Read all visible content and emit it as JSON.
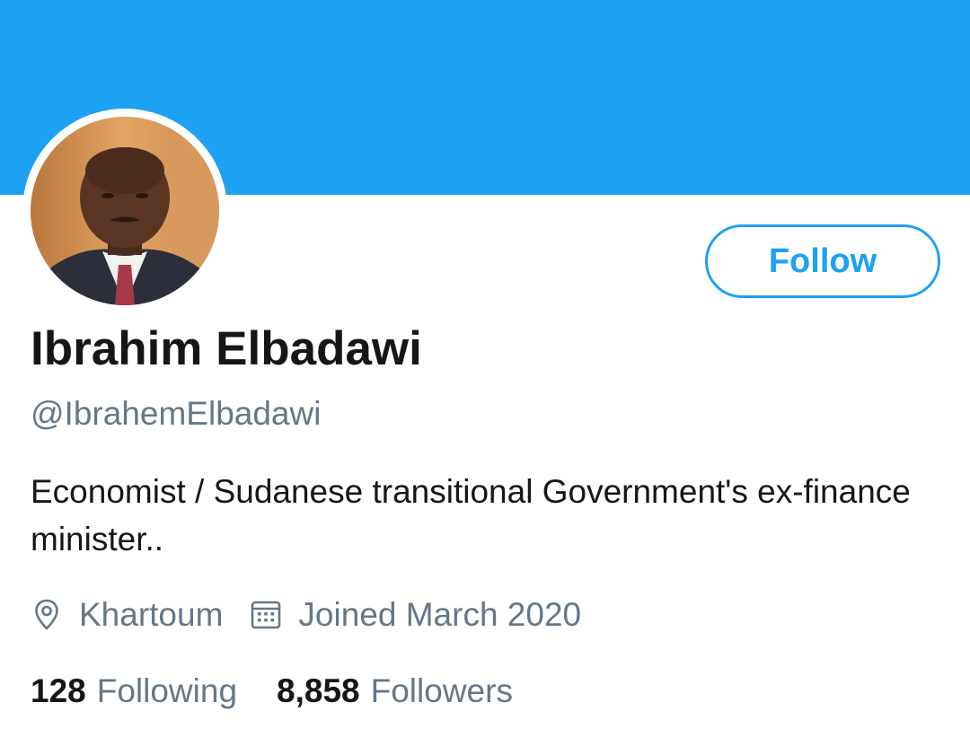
{
  "colors": {
    "banner": "#1da1f2",
    "accent": "#1da1f2",
    "text_primary": "#14171a",
    "text_secondary": "#657786",
    "avatar_ring": "#ffffff"
  },
  "profile": {
    "display_name": "Ibrahim Elbadawi",
    "handle": "@IbrahemElbadawi",
    "bio": "Economist / Sudanese transitional Government's ex-finance minister..",
    "location": "Khartoum",
    "location_icon": "location-pin-icon",
    "joined": "Joined March 2020",
    "joined_icon": "calendar-icon",
    "avatar_icon": "profile-photo"
  },
  "actions": {
    "follow_label": "Follow"
  },
  "stats": {
    "following_count": "128",
    "following_label": "Following",
    "followers_count": "8,858",
    "followers_label": "Followers"
  }
}
